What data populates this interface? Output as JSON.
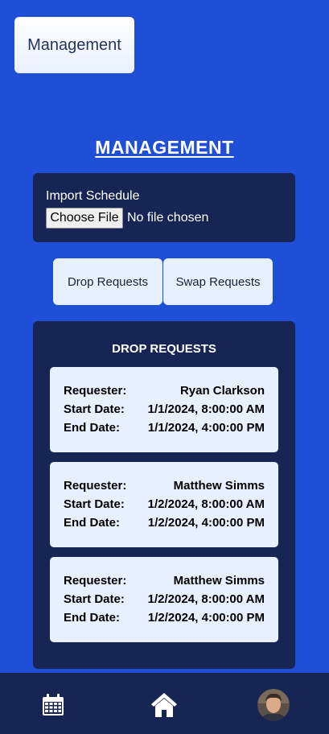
{
  "header": {
    "management_button": "Management"
  },
  "title": "MANAGEMENT",
  "import_section": {
    "label": "Import Schedule",
    "choose_file": "Choose File",
    "no_file": "No file chosen"
  },
  "tabs": [
    {
      "label": "Drop Requests"
    },
    {
      "label": "Swap Requests"
    }
  ],
  "drop_panel": {
    "title": "DROP REQUESTS",
    "field_labels": {
      "requester": "Requester:",
      "start": "Start Date:",
      "end": "End Date:"
    },
    "requests": [
      {
        "requester": "Ryan Clarkson",
        "start": "1/1/2024, 8:00:00 AM",
        "end": "1/1/2024, 4:00:00 PM"
      },
      {
        "requester": "Matthew Simms",
        "start": "1/2/2024, 8:00:00 AM",
        "end": "1/2/2024, 4:00:00 PM"
      },
      {
        "requester": "Matthew Simms",
        "start": "1/2/2024, 8:00:00 AM",
        "end": "1/2/2024, 4:00:00 PM"
      }
    ]
  },
  "bottom_nav": {
    "items": [
      {
        "icon": "calendar-icon"
      },
      {
        "icon": "home-icon"
      },
      {
        "icon": "avatar"
      }
    ]
  },
  "colors": {
    "background": "#1f4fd6",
    "panel": "#172554",
    "card": "#e6f0ff"
  }
}
